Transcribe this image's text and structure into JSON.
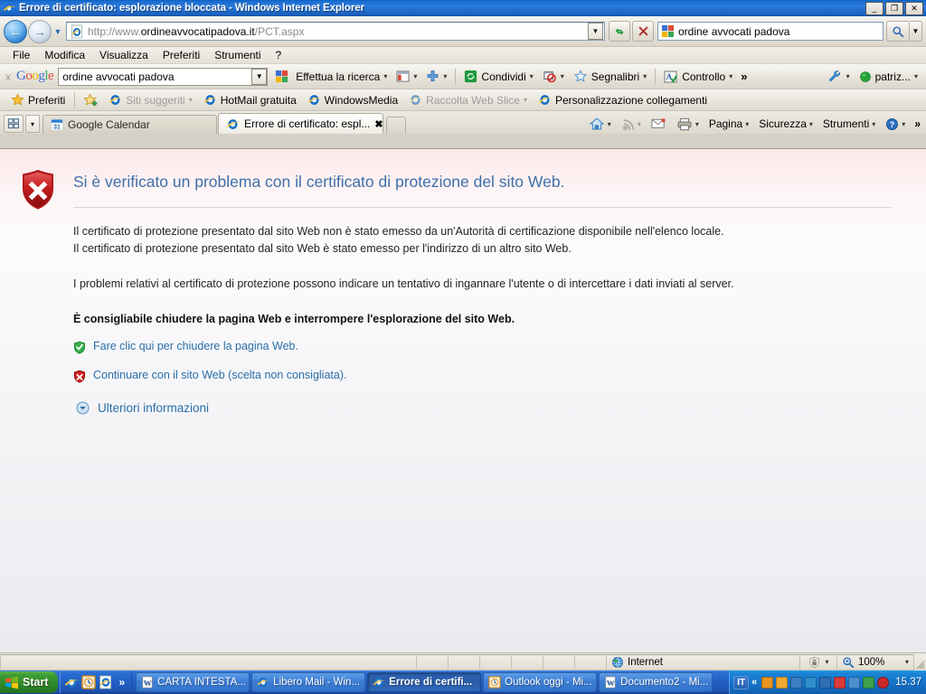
{
  "window": {
    "title": "Errore di certificato: esplorazione bloccata - Windows Internet Explorer",
    "minimize": "_",
    "maximize": "❐",
    "close": "✕"
  },
  "nav": {
    "back_glyph": "←",
    "forward_glyph": "→",
    "history_caret": "▼",
    "address_scheme": "http://www.",
    "address_host": "ordineavvocatipadova.it",
    "address_path": "/PCT.aspx",
    "address_full": "http://www.ordineavvocatipadova.it/PCT.aspx",
    "address_dropdown_caret": "▼",
    "refresh_glyph": "↺",
    "stop_glyph": "✕",
    "search_value": "ordine avvocati padova",
    "search_go_glyph": "🔍",
    "search_caret": "▼"
  },
  "menu": {
    "items": [
      {
        "label": "File"
      },
      {
        "label": "Modifica"
      },
      {
        "label": "Visualizza"
      },
      {
        "label": "Preferiti"
      },
      {
        "label": "Strumenti"
      },
      {
        "label": "?"
      }
    ]
  },
  "google_toolbar": {
    "close_label": "x",
    "logo": {
      "g1": "G",
      "o1": "o",
      "o2": "o",
      "g2": "g",
      "l": "l",
      "e": "e"
    },
    "search_value": "ordine avvocati padova",
    "dropdown_caret": "▼",
    "items": [
      {
        "label": "Effettua la ricerca",
        "icon": "google-icon",
        "caret": "▾"
      },
      {
        "label": "",
        "icon": "sidebar-icon",
        "caret": "▾"
      },
      {
        "label": "",
        "icon": "plus-icon",
        "caret": "▾"
      },
      {
        "label": "Condividi",
        "icon": "share-icon",
        "caret": "▾"
      },
      {
        "label": "",
        "icon": "popup-blocker-icon",
        "caret": "▾"
      },
      {
        "label": "Segnalibri",
        "icon": "star-icon",
        "caret": "▾"
      },
      {
        "label": "Controllo",
        "icon": "spellcheck-icon",
        "caret": "▾"
      }
    ],
    "overflow": "»",
    "settings_label": "",
    "settings_caret": "▾",
    "account_label": "patriz...",
    "account_caret": "▾"
  },
  "favorites_bar": {
    "preferiti_label": "Preferiti",
    "add_icon": "add-to-favorites-icon",
    "items": [
      {
        "label": "Siti suggeriti",
        "icon": "ie-icon",
        "caret": "▾",
        "dim": true
      },
      {
        "label": "HotMail gratuita",
        "icon": "ie-icon",
        "caret": "",
        "dim": false
      },
      {
        "label": "WindowsMedia",
        "icon": "ie-icon",
        "caret": "",
        "dim": false
      },
      {
        "label": "Raccolta Web Slice",
        "icon": "ie-icon",
        "caret": "▾",
        "dim": true
      },
      {
        "label": "Personalizzazione collegamenti",
        "icon": "ie-icon",
        "caret": "",
        "dim": false
      }
    ]
  },
  "tabs": {
    "quicktabs_icon": "quick-tabs-icon",
    "tablist_caret": "▾",
    "items": [
      {
        "label": "Google Calendar",
        "icon": "calendar-icon",
        "icon_text": "31",
        "active": false
      },
      {
        "label": "Errore di certificato: espl...",
        "icon": "ie-icon",
        "active": true,
        "close": "✖"
      }
    ],
    "new_tab_label": ""
  },
  "command_bar": {
    "home_caret": "▾",
    "feeds_caret": "▾",
    "mail_caret": "",
    "print_caret": "▾",
    "items": [
      {
        "label": "Pagina",
        "caret": "▾"
      },
      {
        "label": "Sicurezza",
        "caret": "▾"
      },
      {
        "label": "Strumenti",
        "caret": "▾"
      },
      {
        "label": "",
        "caret": "▾",
        "icon": "help-icon"
      }
    ],
    "overflow": "»"
  },
  "content": {
    "title": "Si è verificato un problema con il certificato di protezione del sito Web.",
    "paragraph_1": "Il certificato di protezione presentato dal sito Web non è stato emesso da un'Autorità di certificazione disponibile nell'elenco locale.",
    "paragraph_2": "Il certificato di protezione presentato dal sito Web è stato emesso per l'indirizzo di un altro sito Web.",
    "paragraph_3": "I problemi relativi al certificato di protezione possono indicare un tentativo di ingannare l'utente o di intercettare i dati inviati al server.",
    "recommendation": "È consigliabile chiudere la pagina Web e interrompere l'esplorazione del sito Web.",
    "option_close": "Fare clic qui per chiudere la pagina Web.",
    "option_continue": "Continuare con il sito Web (scelta non consigliata).",
    "more_info": "Ulteriori informazioni",
    "link_color": "#2b6ea8",
    "title_color": "#3f6fa8"
  },
  "status_bar": {
    "zone_label": "Internet",
    "zone_icon": "globe-icon",
    "protected_icon": "protected-mode-icon",
    "protected_caret": "▾",
    "zoom_label": "100%",
    "zoom_icon": "zoom-icon",
    "zoom_caret": "▾"
  },
  "taskbar": {
    "start_label": "Start",
    "quick_launch": [
      {
        "icon": "ie-icon",
        "name": "internet-explorer"
      },
      {
        "icon": "clock-icon",
        "name": "outlook"
      },
      {
        "icon": "ie-blue-icon",
        "name": "ie-shortcut"
      }
    ],
    "quick_launch_overflow": "»",
    "tasks": [
      {
        "label": "CARTA INTESTA...",
        "icon": "word-icon",
        "active": false
      },
      {
        "label": "Libero Mail - Win...",
        "icon": "ie-icon",
        "active": false
      },
      {
        "label": "Errore di certifi...",
        "icon": "ie-icon",
        "active": true
      },
      {
        "label": "Outlook oggi - Mi...",
        "icon": "clock-icon",
        "active": false
      },
      {
        "label": "Documento2 - Mi...",
        "icon": "word-icon",
        "active": false
      }
    ],
    "tray": {
      "language": "IT",
      "chevron": "«",
      "icons": [
        {
          "name": "java-icon",
          "color": "#e8931f"
        },
        {
          "name": "clock-icon",
          "color": "#f0a830"
        },
        {
          "name": "printer-icon",
          "color": "#3a7fc0"
        },
        {
          "name": "network-icon",
          "color": "#2f8ecf"
        },
        {
          "name": "display-icon",
          "color": "#2f6fb5"
        },
        {
          "name": "antivirus-icon",
          "color": "#d93b3b"
        },
        {
          "name": "volume-icon",
          "color": "#4a8fd0"
        },
        {
          "name": "usb-icon",
          "color": "#3fa04a"
        },
        {
          "name": "security-alert-icon",
          "color": "#cc2a2a"
        }
      ],
      "clock": "15.37"
    }
  }
}
